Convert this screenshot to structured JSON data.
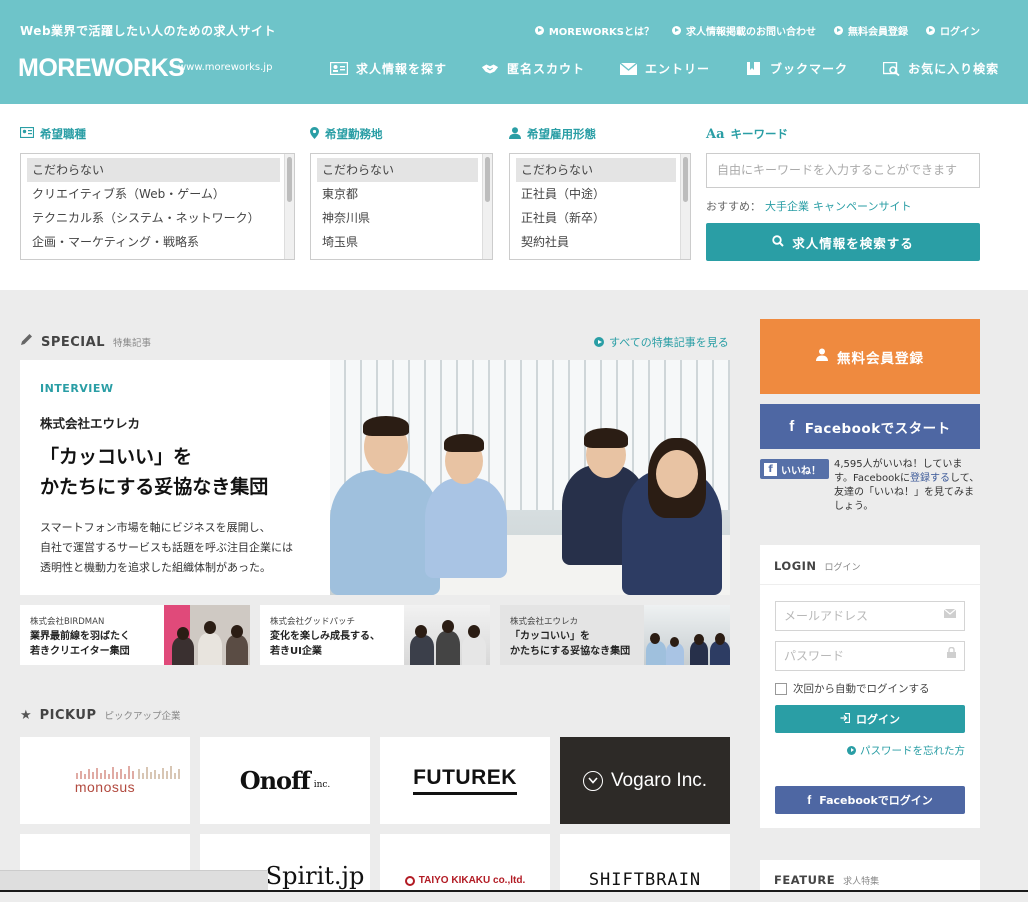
{
  "header": {
    "tagline": "Web業界で活躍したい人のための求人サイト",
    "logo": "MOREWORKS",
    "url": "www.moreworks.jp",
    "toplinks": [
      "MOREWORKSとは？",
      "求人情報掲載のお問い合わせ",
      "無料会員登録",
      "ログイン"
    ],
    "nav": [
      {
        "label": "求人情報を探す",
        "icon": "id-card-icon"
      },
      {
        "label": "匿名スカウト",
        "icon": "handshake-icon"
      },
      {
        "label": "エントリー",
        "icon": "envelope-icon"
      },
      {
        "label": "ブックマーク",
        "icon": "bookmark-icon"
      },
      {
        "label": "お気に入り検索",
        "icon": "search-favorite-icon"
      }
    ]
  },
  "search": {
    "job_type": {
      "label": "希望職種",
      "options": [
        "こだわらない",
        "クリエイティブ系（Web・ゲーム）",
        "テクニカル系（システム・ネットワーク）",
        "企画・マーケティング・戦略系"
      ]
    },
    "location": {
      "label": "希望勤務地",
      "options": [
        "こだわらない",
        "東京都",
        "神奈川県",
        "埼玉県"
      ]
    },
    "employment": {
      "label": "希望雇用形態",
      "options": [
        "こだわらない",
        "正社員（中途）",
        "正社員（新卒）",
        "契約社員"
      ]
    },
    "keyword": {
      "label": "キーワード",
      "placeholder": "自由にキーワードを入力することができます",
      "recommend_label": "おすすめ：",
      "recommend_links": [
        "大手企業",
        "キャンペーンサイト"
      ],
      "button": "求人情報を検索する"
    }
  },
  "special": {
    "title": "SPECIAL",
    "subtitle": "特集記事",
    "see_all": "すべての特集記事を見る",
    "feature": {
      "category": "INTERVIEW",
      "company": "株式会社エウレカ",
      "headline1": "「カッコいい」を",
      "headline2": "かたちにする妥協なき集団",
      "desc1": "スマートフォン市場を軸にビジネスを展開し、",
      "desc2": "自社で運営するサービスも話題を呼ぶ注目企業には",
      "desc3": "透明性と機動力を追求した組織体制があった。"
    },
    "cards": [
      {
        "company": "株式会社BIRDMAN",
        "line1": "業界最前線を羽ばたく",
        "line2": "若きクリエイター集団"
      },
      {
        "company": "株式会社グッドパッチ",
        "line1": "変化を楽しみ成長する、",
        "line2": "若きUI企業"
      },
      {
        "company": "株式会社エウレカ",
        "line1": "「カッコいい」を",
        "line2": "かたちにする妥協なき集団"
      }
    ]
  },
  "pickup": {
    "title": "PICKUP",
    "subtitle": "ピックアップ企業",
    "logos": [
      "monosus",
      "Onoff",
      "inc.",
      "FUTUREK",
      "Vogaro Inc.",
      "Spirit.jp",
      "TAIYO KIKAKU co.,ltd.",
      "SHIFTBRAIN"
    ]
  },
  "sidebar": {
    "register": "無料会員登録",
    "facebook_start": "Facebookでスタート",
    "like_button": "いいね！",
    "like_text1": "4,595人がいいね！しています。Facebookに",
    "like_link": "登録する",
    "like_text2": "して、友達の「いいね！」を見てみましょう。",
    "login": {
      "title": "LOGIN",
      "subtitle": "ログイン",
      "email_placeholder": "メールアドレス",
      "password_placeholder": "パスワード",
      "remember": "次回から自動でログインする",
      "button": "ログイン",
      "forgot": "パスワードを忘れた方",
      "facebook": "Facebookでログイン"
    },
    "feature": {
      "title": "FEATURE",
      "subtitle": "求人特集"
    }
  },
  "colors": {
    "header": "#6ec4c9",
    "accent": "#2a9ea5",
    "register": "#ef8a3f",
    "facebook": "#4e67a3"
  }
}
